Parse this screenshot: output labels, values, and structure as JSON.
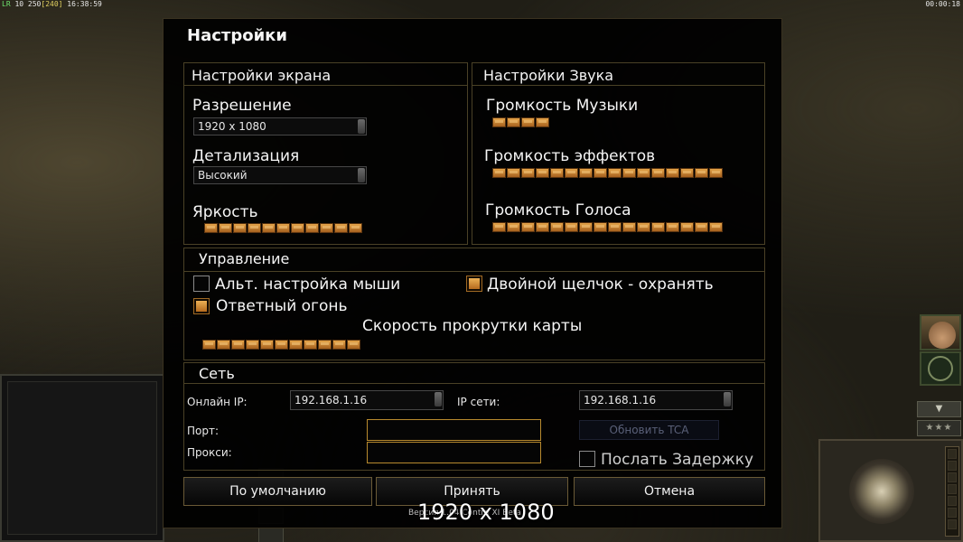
{
  "hud": {
    "fps_prefix": "LR",
    "fps_values": "10 250",
    "fps_bracket": "[240]",
    "clock_left": "16:38:59",
    "clock_right": "00:00:18"
  },
  "dialog": {
    "title": "Настройки",
    "screen": {
      "title": "Настройки экрана",
      "resolution_label": "Разрешение",
      "resolution_value": "1920 x 1080",
      "detail_label": "Детализация",
      "detail_value": "Высокий",
      "brightness_label": "Яркость",
      "brightness_level": 11
    },
    "sound": {
      "title": "Настройки Звука",
      "music_label": "Громкость Музыки",
      "music_level": 4,
      "effects_label": "Громкость эффектов",
      "effects_level": 16,
      "voice_label": "Громкость Голоса",
      "voice_level": 16
    },
    "controls": {
      "title": "Управление",
      "alt_mouse_label": "Альт. настройка мыши",
      "alt_mouse_checked": false,
      "double_click_label": "Двойной щелчок - охранять",
      "double_click_checked": true,
      "return_fire_label": "Ответный огонь",
      "return_fire_checked": true,
      "scroll_speed_label": "Скорость прокрутки карты",
      "scroll_speed_level": 11
    },
    "network": {
      "title": "Сеть",
      "online_ip_label": "Онлайн IP:",
      "online_ip_value": "192.168.1.16",
      "lan_ip_label": "IP сети:",
      "lan_ip_value": "192.168.1.16",
      "port_label": "Порт:",
      "port_value": "",
      "proxy_label": "Прокси:",
      "proxy_value": "",
      "refresh_tca_label": "Обновить TCA",
      "send_delay_label": "Послать Задержку",
      "send_delay_checked": false
    },
    "buttons": {
      "default_label": "По умолчанию",
      "accept_label": "Принять",
      "cancel_label": "Отмена"
    }
  },
  "footer": {
    "version_text": "Версия 1.04 Contra XI Beta",
    "resolution_overlay": "1920 x 1080"
  },
  "colors": {
    "accent_orange": "#e6a54a",
    "field_border": "#b88a2e",
    "panel_border": "#4a4126"
  }
}
